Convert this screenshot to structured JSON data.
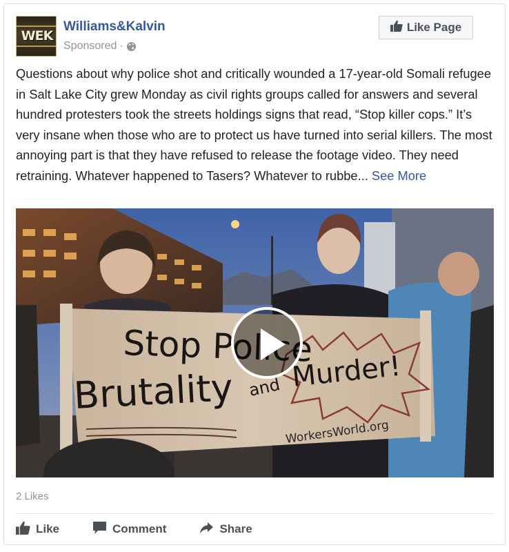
{
  "post": {
    "page_name": "Williams&Kalvin",
    "sponsored_label": "Sponsored",
    "sponsored_sep": "·",
    "logo_text": "WEK",
    "like_page_label": "Like Page",
    "body_text": "Questions about why police shot and critically wounded a 17-year-old Somali refugee in Salt Lake City grew Monday as civil rights groups called for answers and several hundred protesters took the streets holdings signs that read, “Stop killer cops.” It’s very insane when those who are to protect us have turned into serial killers. The most annoying part is that they have refused to release the footage video. They need retraining. Whatever happened to Tasers? Whatever to rubbe...",
    "see_more_label": "See More"
  },
  "media": {
    "sign_line1": "Stop Police",
    "sign_line2": "Brutality",
    "sign_and": "and",
    "sign_murder": "Murder!",
    "sign_url": "WorkersWorld.org"
  },
  "footer": {
    "likes_count": "2 Likes",
    "like_label": "Like",
    "comment_label": "Comment",
    "share_label": "Share"
  },
  "colors": {
    "link_blue": "#365899",
    "muted_gray": "#90949c",
    "action_gray": "#4b4f56"
  },
  "icons": {
    "header_globe": "globe-icon",
    "like_page": "thumbs-up-icon",
    "play": "play-icon",
    "like": "thumbs-up-icon",
    "comment": "speech-bubble-icon",
    "share": "share-arrow-icon"
  }
}
